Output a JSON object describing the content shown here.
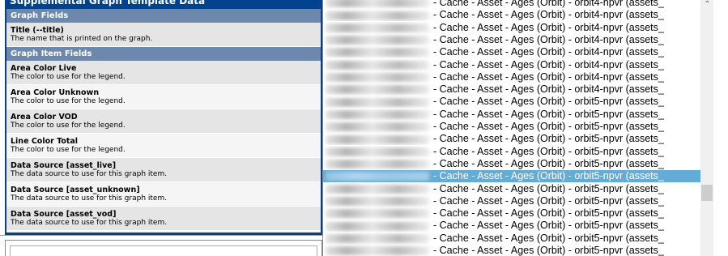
{
  "panel": {
    "title": "Supplemental Graph Template Data",
    "graph_fields_header": "Graph Fields",
    "graph_item_fields_header": "Graph Item Fields",
    "graph_fields": [
      {
        "label": "Title (--title)",
        "desc": "The name that is printed on the graph."
      }
    ],
    "item_fields": [
      {
        "label": "Area Color Live",
        "desc": "The color to use for the legend."
      },
      {
        "label": "Area Color Unknown",
        "desc": "The color to use for the legend."
      },
      {
        "label": "Area Color VOD",
        "desc": "The color to use for the legend."
      },
      {
        "label": "Line Color Total",
        "desc": "The color to use for the legend."
      },
      {
        "label": "Data Source [asset_live]",
        "desc": "The data source to use for this graph item."
      },
      {
        "label": "Data Source [asset_unknown]",
        "desc": "The data source to use for this graph item."
      },
      {
        "label": "Data Source [asset_vod]",
        "desc": "The data source to use for this graph item."
      }
    ]
  },
  "dropdown": {
    "options": [
      "- Cache - Asset - Ages (Orbit) - orbit4-npvr (assets_",
      "- Cache - Asset - Ages (Orbit) - orbit4-npvr (assets_",
      "- Cache - Asset - Ages (Orbit) - orbit4-npvr (assets_",
      "- Cache - Asset - Ages (Orbit) - orbit4-npvr (assets_",
      "- Cache - Asset - Ages (Orbit) - orbit4-npvr (assets_",
      "- Cache - Asset - Ages (Orbit) - orbit4-npvr (assets_",
      "- Cache - Asset - Ages (Orbit) - orbit4-npvr (assets_",
      "- Cache - Asset - Ages (Orbit) - orbit4-npvr (assets_",
      "- Cache - Asset - Ages (Orbit) - orbit5-npvr (assets_",
      "- Cache - Asset - Ages (Orbit) - orbit5-npvr (assets_",
      "- Cache - Asset - Ages (Orbit) - orbit5-npvr (assets_",
      "- Cache - Asset - Ages (Orbit) - orbit5-npvr (assets_",
      "- Cache - Asset - Ages (Orbit) - orbit5-npvr (assets_",
      "- Cache - Asset - Ages (Orbit) - orbit5-npvr (assets_",
      "- Cache - Asset - Ages (Orbit) - orbit5-npvr (assets_",
      "- Cache - Asset - Ages (Orbit) - orbit5-npvr (assets_",
      "- Cache - Asset - Ages (Orbit) - orbit5-npvr (assets_",
      "- Cache - Asset - Ages (Orbit) - orbit5-npvr (assets_",
      "- Cache - Asset - Ages (Orbit) - orbit5-npvr (assets_",
      "- Cache - Asset - Ages (Orbit) - orbit5-npvr (assets_",
      "- Cache - Asset - Ages (Orbit) - orbit5-npvr (assets_"
    ],
    "selected_index": 14,
    "scroll_up_icon": "chevron-up-icon",
    "colors": {
      "selected_bg": "#64acd8",
      "panel_bg": "#00438c",
      "section_bg": "#6d88ad"
    }
  }
}
